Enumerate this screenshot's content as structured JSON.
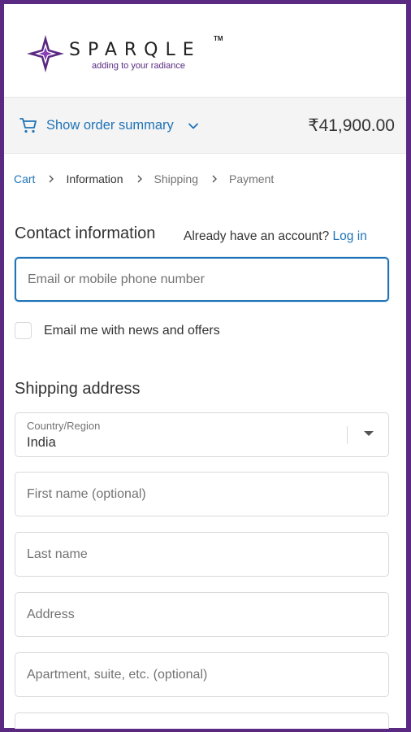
{
  "brand": {
    "name": "SPARQLE",
    "trademark": "TM",
    "tagline": "adding to your radiance",
    "accent": "#5a2a82"
  },
  "order_summary": {
    "toggle_label": "Show order summary",
    "total": "₹41,900.00",
    "icons": [
      "cart-icon",
      "chevron-down-icon"
    ]
  },
  "breadcrumb": {
    "items": [
      "Cart",
      "Information",
      "Shipping",
      "Payment"
    ]
  },
  "contact": {
    "title": "Contact information",
    "login_prompt": "Already have an account?",
    "login_link": "Log in",
    "email_placeholder": "Email or mobile phone number",
    "newsletter_label": "Email me with news and offers"
  },
  "shipping": {
    "title": "Shipping address",
    "country_label": "Country/Region",
    "country_value": "India",
    "first_name_placeholder": "First name (optional)",
    "last_name_placeholder": "Last name",
    "address_placeholder": "Address",
    "apartment_placeholder": "Apartment, suite, etc. (optional)"
  },
  "colors": {
    "link": "#1f73b7",
    "frame": "#5a2a82",
    "summary_bg": "#f4f4f4"
  }
}
